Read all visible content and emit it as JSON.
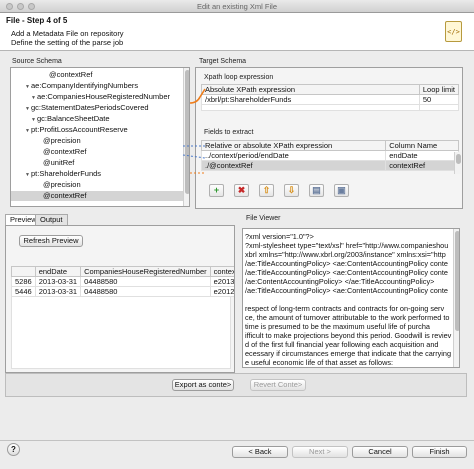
{
  "window": {
    "title": "Edit an existing Xml File"
  },
  "header": {
    "step": "File - Step 4 of 5",
    "line1": "Add a Metadata File on repository",
    "line2": "Define the setting of the parse job"
  },
  "source_schema": {
    "label": "Source Schema",
    "nodes": [
      {
        "label": "@contextRef",
        "depth": 4,
        "expander": "",
        "selected": false
      },
      {
        "label": "ae:CompanyIdentifyingNumbers",
        "depth": 1,
        "expander": "open",
        "selected": false
      },
      {
        "label": "ae:CompaniesHouseRegisteredNumber",
        "depth": 2,
        "expander": "open",
        "selected": false
      },
      {
        "label": "gc:StatementDatesPeriodsCovered",
        "depth": 1,
        "expander": "open",
        "selected": false
      },
      {
        "label": "gc:BalanceSheetDate",
        "depth": 2,
        "expander": "open",
        "selected": false
      },
      {
        "label": "pt:ProfitLossAccountReserve",
        "depth": 1,
        "expander": "open",
        "selected": false
      },
      {
        "label": "@precision",
        "depth": 3,
        "expander": "",
        "selected": false
      },
      {
        "label": "@contextRef",
        "depth": 3,
        "expander": "",
        "selected": false
      },
      {
        "label": "@unitRef",
        "depth": 3,
        "expander": "",
        "selected": false
      },
      {
        "label": "pt:ShareholderFunds",
        "depth": 1,
        "expander": "open",
        "selected": false
      },
      {
        "label": "@precision",
        "depth": 3,
        "expander": "",
        "selected": false
      },
      {
        "label": "@contextRef",
        "depth": 3,
        "expander": "",
        "selected": true
      }
    ]
  },
  "target_schema": {
    "label": "Target Schema",
    "loop_title": "Xpath loop expression",
    "loop_headers": [
      "Absolute XPath expression",
      "Loop limit"
    ],
    "loop_rows": [
      {
        "xpath": "/xbrl/pt:ShareholderFunds",
        "limit": "50"
      }
    ],
    "fields_title": "Fields to extract",
    "fields_headers": [
      "Relative or absolute XPath expression",
      "Column Name"
    ],
    "fields_rows": [
      {
        "xpath": "../context/period/endDate",
        "col": "endDate",
        "selected": false
      },
      {
        "xpath": "./@contextRef",
        "col": "contextRef",
        "selected": true
      }
    ],
    "toolbar": [
      {
        "icon": "add-icon",
        "glyph": "+",
        "color": "#2f9a2f"
      },
      {
        "icon": "remove-icon",
        "glyph": "✖",
        "color": "#c62828"
      },
      {
        "icon": "move-up-icon",
        "glyph": "⇧",
        "color": "#d8901a"
      },
      {
        "icon": "move-down-icon",
        "glyph": "⇩",
        "color": "#d8901a"
      },
      {
        "icon": "copy-icon",
        "glyph": "▤",
        "color": "#6b7fa0"
      },
      {
        "icon": "paste-icon",
        "glyph": "▣",
        "color": "#6b7fa0"
      }
    ]
  },
  "preview": {
    "tabs": [
      "Preview",
      "Output"
    ],
    "refresh_label": "Refresh Preview",
    "headers": [
      "",
      "endDate",
      "CompaniesHouseRegisteredNumber",
      "contextRef"
    ],
    "rows": [
      [
        "5286",
        "2013-03-31",
        "04488580",
        "e2013"
      ],
      [
        "5446",
        "2013-03-31",
        "04488580",
        "e2012"
      ]
    ]
  },
  "file_viewer": {
    "label": "File Viewer",
    "lines": [
      "?xml version=\"1.0\"?>",
      "?xml-stylesheet type=\"text/xsl\" href=\"http://www.companieshou",
      "xbrl xmlns=\"http://www.xbrl.org/2003/instance\" xmlns:xsi=\"http",
      "/ae:TitleAccountingPolicy> <ae:ContentAccountingPolicy conte",
      "/ae:TitleAccountingPolicy> <ae:ContentAccountingPolicy conte",
      "/ae:ContentAccountingPolicy> </ae:TitleAccountingPolicy>",
      "/ae:TitleAccountingPolicy> <ae:ContentAccountingPolicy conte",
      "",
      "respect of long-term contracts and contracts for on-going serv",
      "ce, the amount of turnover attributable to the work performed to",
      "time is presumed to be the maximum useful life of purcha",
      "ifficult to make projections beyond this period. Goodwill is reviev",
      "d of the first full financial year following each acquisition and",
      "ecessary if circumstances emerge that indicate that the carrying",
      "e useful economic life of that asset as follows:"
    ]
  },
  "export": {
    "export_label": "Export as conte>",
    "revert_label": "Revert Conte>"
  },
  "footer": {
    "help_label": "?",
    "back_label": "< Back",
    "next_label": "Next >",
    "cancel_label": "Cancel",
    "finish_label": "Finish"
  }
}
